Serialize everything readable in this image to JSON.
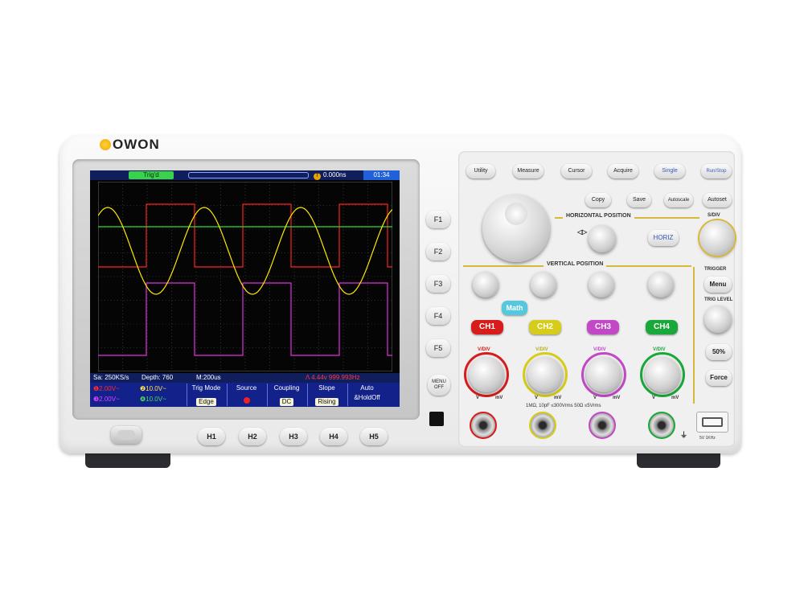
{
  "brand": "OWON",
  "screen": {
    "status": "Trig'd",
    "trigger_position": "0.000ns",
    "clock": "01:34",
    "info": {
      "sample_rate": "Sa: 250KS/s",
      "depth": "Depth: 760",
      "timebase": "M:200us",
      "trigger_readout": "  Λ  4.44v  999.993Hz"
    },
    "channel_readouts": [
      {
        "label": "2.00V~",
        "color": "#ff2a2a"
      },
      {
        "label": "10.0V~",
        "color": "#ffe44a"
      },
      {
        "label": "2.00V~",
        "color": "#e040ff"
      },
      {
        "label": "10.0V~",
        "color": "#4ddc4d"
      }
    ],
    "menu": [
      {
        "title": "Trig Mode",
        "value": "Edge"
      },
      {
        "title": "Source",
        "value": ""
      },
      {
        "title": "Coupling",
        "value": "DC"
      },
      {
        "title": "Slope",
        "value": "Rising"
      },
      {
        "title": "Auto",
        "value": "&HoldOff"
      }
    ],
    "waveforms": {
      "colors": {
        "ch1": "#ff2020",
        "ch2": "#ffe600",
        "ch3": "#e030e0",
        "ch4": "#33dd33"
      }
    }
  },
  "side_buttons": [
    "F1",
    "F2",
    "F3",
    "F4",
    "F5"
  ],
  "menu_off": [
    "MENU",
    "OFF"
  ],
  "hotkeys": [
    "H1",
    "H2",
    "H3",
    "H4",
    "H5"
  ],
  "panel": {
    "top_row": [
      "Utility",
      "Measure",
      "Cursor",
      "Acquire",
      "Single",
      "Run/Stop"
    ],
    "second_row": [
      "Copy",
      "Save",
      "Autoscale",
      "Autoset"
    ],
    "horizontal_position": "HORIZONTAL POSITION",
    "horiz_button": "HORIZ",
    "s_div": "S/DIV",
    "trigger": "TRIGGER",
    "menu": "Menu",
    "trig_level": "TRIG LEVEL",
    "fifty": "50%",
    "force": "Force",
    "vertical_position": "VERTICAL  POSITION",
    "math": "Math",
    "channels": [
      {
        "label": "CH1",
        "color": "#d81c1c"
      },
      {
        "label": "CH2",
        "color": "#d6cc1a"
      },
      {
        "label": "CH3",
        "color": "#c248c8"
      },
      {
        "label": "CH4",
        "color": "#1aa83a"
      }
    ],
    "v_div": "V/DIV",
    "v": "V",
    "mv": "mV",
    "specs": "1MΩ, 10pF ≤300Vrms  50Ω ≤5Vrms",
    "probe_comp": "5V 1KHz"
  }
}
